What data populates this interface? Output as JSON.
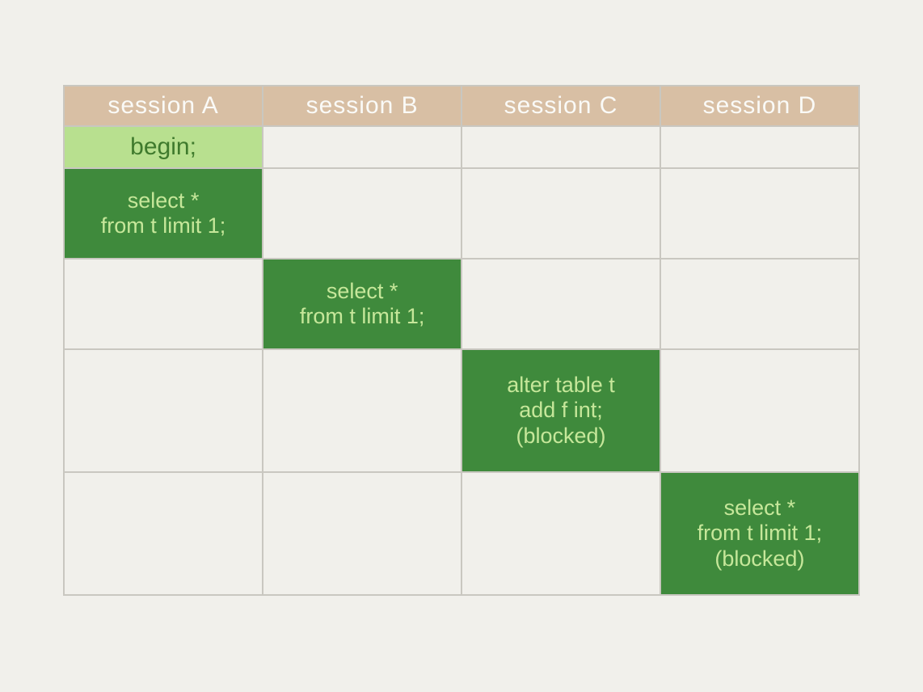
{
  "headers": {
    "a": "session A",
    "b": "session B",
    "c": "session C",
    "d": "session D"
  },
  "cells": {
    "r0a": {
      "lines": [
        "begin;"
      ]
    },
    "r1a": {
      "lines": [
        "select *",
        "from t limit 1;"
      ]
    },
    "r2b": {
      "lines": [
        "select *",
        "from t limit 1;"
      ]
    },
    "r3c": {
      "lines": [
        "alter table t",
        "add f int;",
        "(blocked)"
      ]
    },
    "r4d": {
      "lines": [
        "select *",
        "from t limit 1;",
        "(blocked)"
      ]
    }
  }
}
